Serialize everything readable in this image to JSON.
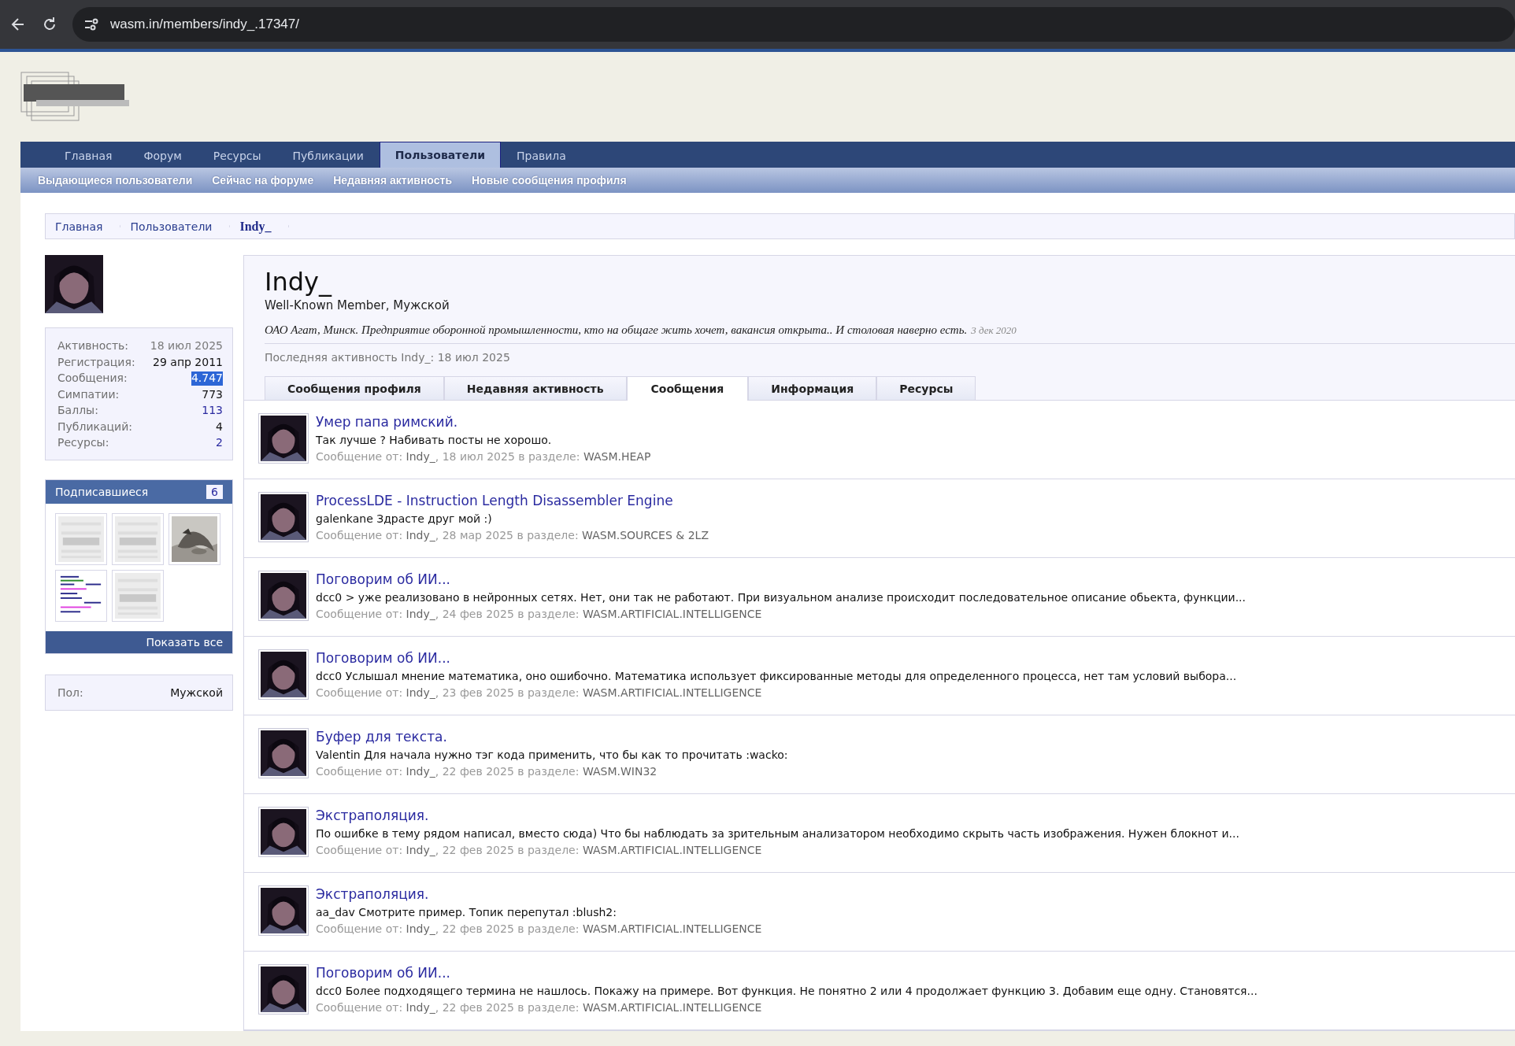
{
  "browser": {
    "url": "wasm.in/members/indy_.17347/"
  },
  "nav": {
    "tabs": [
      {
        "label": "Главная",
        "selected": false
      },
      {
        "label": "Форум",
        "selected": false
      },
      {
        "label": "Ресурсы",
        "selected": false
      },
      {
        "label": "Публикации",
        "selected": false
      },
      {
        "label": "Пользователи",
        "selected": true
      },
      {
        "label": "Правила",
        "selected": false
      }
    ],
    "subnav": [
      "Выдающиеся пользователи",
      "Сейчас на форуме",
      "Недавняя активность",
      "Новые сообщения профиля"
    ]
  },
  "breadcrumb": [
    {
      "label": "Главная",
      "selected": false
    },
    {
      "label": "Пользователи",
      "selected": false
    },
    {
      "label": "Indy_",
      "selected": true
    }
  ],
  "sidebar": {
    "stats": [
      {
        "label": "Активность:",
        "value": "18 июл 2025",
        "kind": "muted",
        "highlighted": false
      },
      {
        "label": "Регистрация:",
        "value": "29 апр 2011",
        "kind": "text",
        "highlighted": false
      },
      {
        "label": "Сообщения:",
        "value": "4.747",
        "kind": "text",
        "highlighted": true
      },
      {
        "label": "Симпатии:",
        "value": "773",
        "kind": "text",
        "highlighted": false
      },
      {
        "label": "Баллы:",
        "value": "113",
        "kind": "link",
        "highlighted": false
      },
      {
        "label": "Публикаций:",
        "value": "4",
        "kind": "text",
        "highlighted": false
      },
      {
        "label": "Ресурсы:",
        "value": "2",
        "kind": "link",
        "highlighted": false
      }
    ],
    "followers": {
      "title": "Подписавшиеся",
      "count": "6",
      "avatars": [
        {
          "kind": "logo"
        },
        {
          "kind": "logo"
        },
        {
          "kind": "picture"
        },
        {
          "kind": "code"
        },
        {
          "kind": "logo"
        }
      ],
      "show_all": "Показать все"
    },
    "info": [
      {
        "label": "Пол:",
        "value": "Мужской"
      }
    ]
  },
  "profile": {
    "name": "Indy_",
    "subtitle": "Well-Known Member, Мужской",
    "status": "ОАО Агат, Минск. Предприятие оборонной промышленности, кто на общаге жить хочет, вакансия открыта.. И столовая наверно есть.",
    "status_date": "3 дек 2020",
    "last_activity": "Последняя активность Indy_: 18 июл 2025",
    "tabs": [
      {
        "label": "Сообщения профиля",
        "selected": false
      },
      {
        "label": "Недавняя активность",
        "selected": false
      },
      {
        "label": "Сообщения",
        "selected": true
      },
      {
        "label": "Информация",
        "selected": false
      },
      {
        "label": "Ресурсы",
        "selected": false
      }
    ]
  },
  "posts": [
    {
      "title": "Умер папа римский.",
      "snippet": "Так лучше ? Набивать посты не хорошо.",
      "meta_label": "Сообщение от:",
      "author": "Indy_",
      "date": ", 18 июл 2025 в разделе:",
      "section": "WASM.HEAP"
    },
    {
      "title": "ProcessLDE - Instruction Length Disassembler Engine",
      "snippet": "galenkane Здрасте друг мой :)",
      "meta_label": "Сообщение от:",
      "author": "Indy_",
      "date": ", 28 мар 2025 в разделе:",
      "section": "WASM.SOURCES & 2LZ"
    },
    {
      "title": "Поговорим об ИИ...",
      "snippet": "dcc0 > уже реализовано в нейронных сетях. Нет, они так не работают. При визуальном анализе происходит последовательное описание обьекта, функции...",
      "meta_label": "Сообщение от:",
      "author": "Indy_",
      "date": ", 24 фев 2025 в разделе:",
      "section": "WASM.ARTIFICIAL.INTELLIGENCE"
    },
    {
      "title": "Поговорим об ИИ...",
      "snippet": "dcc0 Услышал мнение математика, оно ошибочно. Математика использует фиксированные методы для определенного процесса, нет там условий выбора...",
      "meta_label": "Сообщение от:",
      "author": "Indy_",
      "date": ", 23 фев 2025 в разделе:",
      "section": "WASM.ARTIFICIAL.INTELLIGENCE"
    },
    {
      "title": "Буфер для текста.",
      "snippet": "Valentin Для начала нужно тэг кода применить, что бы как то прочитать :wacko:",
      "meta_label": "Сообщение от:",
      "author": "Indy_",
      "date": ", 22 фев 2025 в разделе:",
      "section": "WASM.WIN32"
    },
    {
      "title": "Экстраполяция.",
      "snippet": "По ошибке в тему рядом написал, вместо сюда) Что бы наблюдать за зрительным анализатором необходимо скрыть часть изображения. Нужен блокнот и...",
      "meta_label": "Сообщение от:",
      "author": "Indy_",
      "date": ", 22 фев 2025 в разделе:",
      "section": "WASM.ARTIFICIAL.INTELLIGENCE"
    },
    {
      "title": "Экстраполяция.",
      "snippet": "aa_dav Смотрите пример. Топик перепутал :blush2:",
      "meta_label": "Сообщение от:",
      "author": "Indy_",
      "date": ", 22 фев 2025 в разделе:",
      "section": "WASM.ARTIFICIAL.INTELLIGENCE"
    },
    {
      "title": "Поговорим об ИИ...",
      "snippet": "dcc0 Более подходящего термина не нашлось. Покажу на примере. Вот функция. Не понятно 2 или 4 продолжает функцию 3. Добавим еще одну. Становятся...",
      "meta_label": "Сообщение от:",
      "author": "Indy_",
      "date": ", 22 фев 2025 в разделе:",
      "section": "WASM.ARTIFICIAL.INTELLIGENCE"
    }
  ]
}
